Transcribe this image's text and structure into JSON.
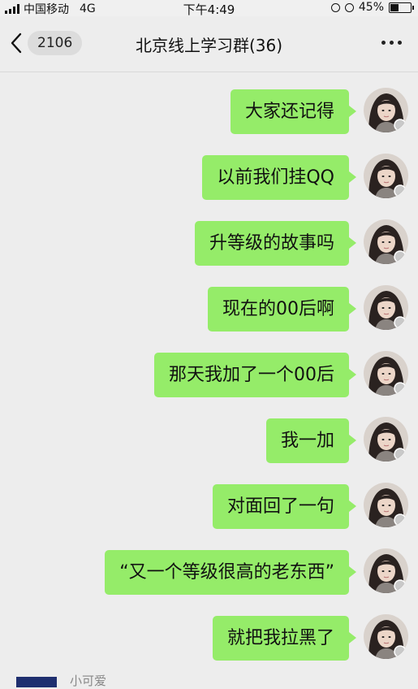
{
  "status_bar": {
    "carrier": "中国移动",
    "network": "4G",
    "time": "下午4:49",
    "battery_percent": "45%",
    "battery_level": 0.45
  },
  "nav": {
    "back_icon": "chevron-left-icon",
    "unread_count": "2106",
    "title": "北京线上学习群(36)",
    "more_icon": "more-dots-icon"
  },
  "messages": [
    {
      "text": "大家还记得"
    },
    {
      "text": "以前我们挂QQ"
    },
    {
      "text": "升等级的故事吗"
    },
    {
      "text": "现在的00后啊"
    },
    {
      "text": "那天我加了一个00后"
    },
    {
      "text": "我一加"
    },
    {
      "text": "对面回了一句"
    },
    {
      "text": "“又一个等级很高的老东西”"
    },
    {
      "text": "就把我拉黑了"
    }
  ],
  "bottom": {
    "sender_name": "小可爱"
  },
  "colors": {
    "bubble": "#95ec69",
    "background": "#ededed"
  }
}
